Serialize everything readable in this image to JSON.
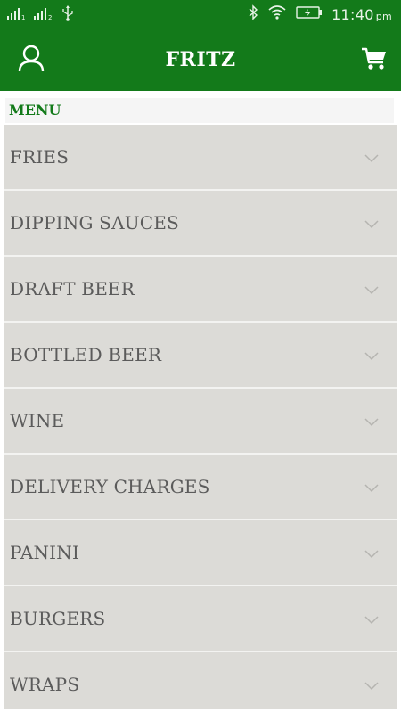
{
  "status_bar": {
    "time": "11:40",
    "ampm": "pm",
    "icons": [
      "signal-icon",
      "signal-2-icon",
      "usb-icon",
      "bluetooth-icon",
      "wifi-icon",
      "battery-charging-icon"
    ]
  },
  "app_bar": {
    "title": "FRITZ",
    "left_icon": "user-icon",
    "right_icon": "cart-icon"
  },
  "menu": {
    "header": "MENU",
    "items": [
      {
        "label": "FRIES"
      },
      {
        "label": "DIPPING SAUCES"
      },
      {
        "label": "DRAFT BEER"
      },
      {
        "label": "BOTTLED BEER"
      },
      {
        "label": "WINE"
      },
      {
        "label": "DELIVERY CHARGES"
      },
      {
        "label": "PANINI"
      },
      {
        "label": "BURGERS"
      },
      {
        "label": "WRAPS"
      }
    ]
  },
  "colors": {
    "primary": "#137a1a",
    "item_bg": "#dcdbd7",
    "item_text": "#5b5b5b"
  }
}
